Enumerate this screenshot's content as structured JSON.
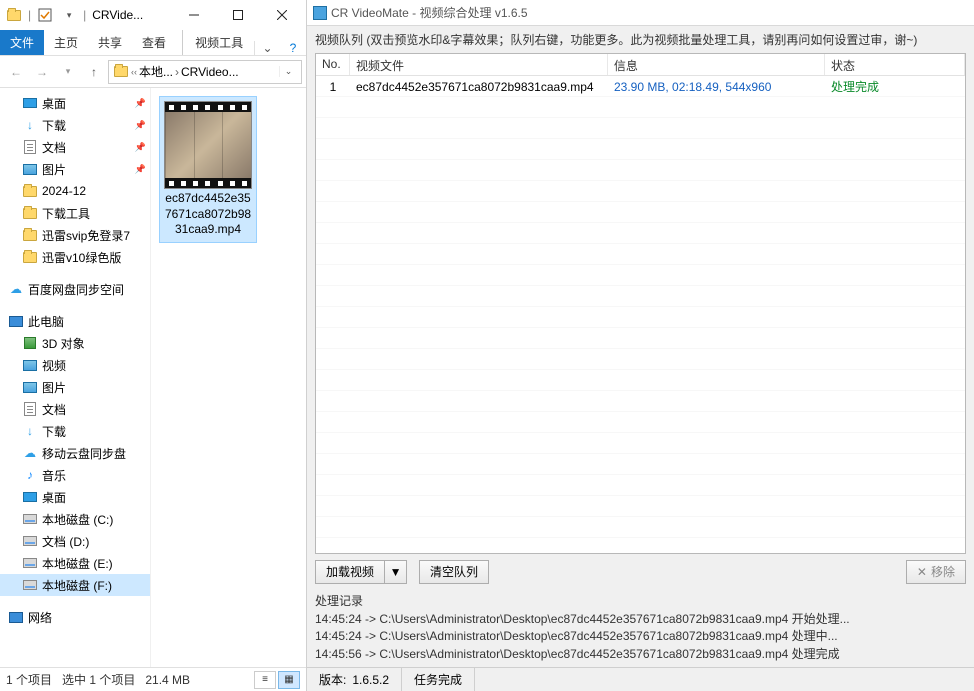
{
  "explorer": {
    "title": "CRVide...",
    "ribbon": {
      "file": "文件",
      "home": "主页",
      "share": "共享",
      "view": "查看",
      "video_tools": "视频工具"
    },
    "breadcrumb": {
      "seg1": "本地...",
      "seg2": "CRVideo..."
    },
    "tree": {
      "quick": [
        {
          "label": "桌面",
          "icon": "desktop",
          "pinned": true
        },
        {
          "label": "下载",
          "icon": "download",
          "pinned": true
        },
        {
          "label": "文档",
          "icon": "document",
          "pinned": true
        },
        {
          "label": "图片",
          "icon": "image",
          "pinned": true
        },
        {
          "label": "2024-12",
          "icon": "folder"
        },
        {
          "label": "下载工具",
          "icon": "folder"
        },
        {
          "label": "迅雷svip免登录7",
          "icon": "folder"
        },
        {
          "label": "迅雷v10绿色版",
          "icon": "folder"
        }
      ],
      "baidu": "百度网盘同步空间",
      "pc": "此电脑",
      "pc_items": [
        {
          "label": "3D 对象",
          "icon": "cube"
        },
        {
          "label": "视频",
          "icon": "image"
        },
        {
          "label": "图片",
          "icon": "image"
        },
        {
          "label": "文档",
          "icon": "document"
        },
        {
          "label": "下载",
          "icon": "download"
        },
        {
          "label": "移动云盘同步盘",
          "icon": "cloud"
        },
        {
          "label": "音乐",
          "icon": "music"
        },
        {
          "label": "桌面",
          "icon": "desktop"
        },
        {
          "label": "本地磁盘 (C:)",
          "icon": "hdd"
        },
        {
          "label": "文档 (D:)",
          "icon": "hdd"
        },
        {
          "label": "本地磁盘 (E:)",
          "icon": "hdd"
        },
        {
          "label": "本地磁盘 (F:)",
          "icon": "hdd",
          "sel": true
        }
      ],
      "network": "网络"
    },
    "file_item": "ec87dc4452e357671ca8072b9831caa9.mp4",
    "status": {
      "count": "1 个项目",
      "selected": "选中 1 个项目",
      "size": "21.4 MB"
    }
  },
  "videomate": {
    "title": "CR VideoMate - 视频综合处理 v1.6.5",
    "hint": "视频队列 (双击预览水印&字幕效果；队列右键，功能更多。此为视频批量处理工具，请别再问如何设置过审，谢~)",
    "columns": {
      "no": "No.",
      "file": "视频文件",
      "info": "信息",
      "status": "状态"
    },
    "rows": [
      {
        "no": "1",
        "file": "ec87dc4452e357671ca8072b9831caa9.mp4",
        "info": "23.90 MB, 02:18.49, 544x960",
        "status": "处理完成"
      }
    ],
    "buttons": {
      "load": "加载视频",
      "clear": "清空队列",
      "remove": "移除"
    },
    "log_label": "处理记录",
    "log": "14:45:24 -> C:\\Users\\Administrator\\Desktop\\ec87dc4452e357671ca8072b9831caa9.mp4 开始处理...\n14:45:24 -> C:\\Users\\Administrator\\Desktop\\ec87dc4452e357671ca8072b9831caa9.mp4 处理中...\n14:45:56 -> C:\\Users\\Administrator\\Desktop\\ec87dc4452e357671ca8072b9831caa9.mp4 处理完成",
    "status": {
      "version_label": "版本:",
      "version": "1.6.5.2",
      "task": "任务完成"
    }
  }
}
